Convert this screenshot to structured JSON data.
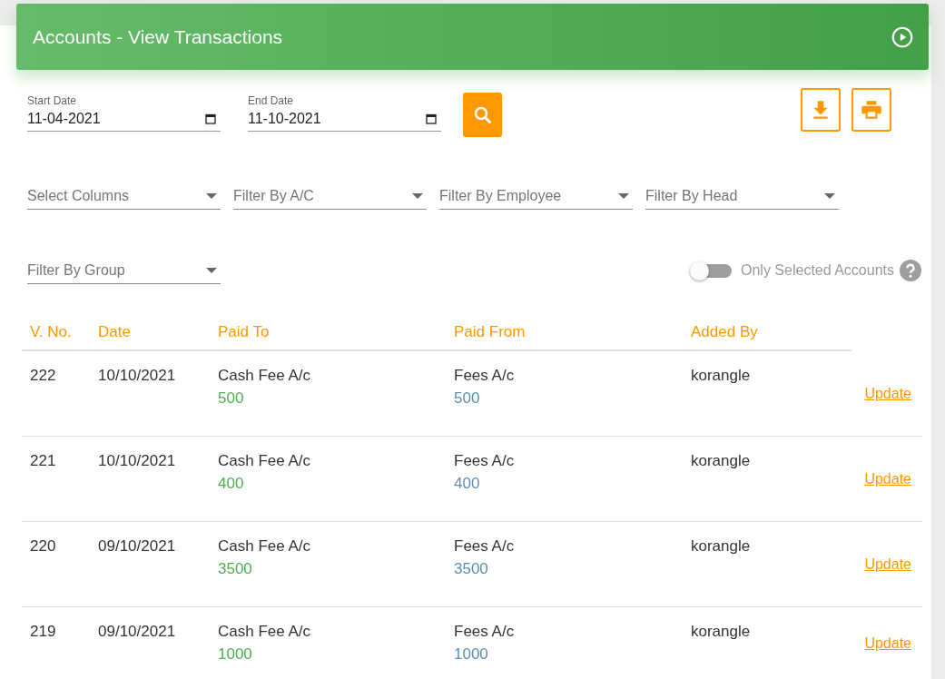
{
  "header": {
    "title": "Accounts - View Transactions"
  },
  "dates": [
    {
      "label": "Start Date",
      "value": "11-04-2021"
    },
    {
      "label": "End Date",
      "value": "11-10-2021"
    }
  ],
  "filters": [
    {
      "placeholder": "Select Columns"
    },
    {
      "placeholder": "Filter By A/C"
    },
    {
      "placeholder": "Filter By Employee"
    },
    {
      "placeholder": "Filter By Head"
    },
    {
      "placeholder": "Filter By Group"
    }
  ],
  "toggle": {
    "label": "Only Selected Accounts",
    "on": false
  },
  "table": {
    "columns": [
      "V. No.",
      "Date",
      "Paid To",
      "Paid From",
      "Added By"
    ],
    "rows": [
      {
        "vno": "222",
        "date": "10/10/2021",
        "paid_to": "Cash Fee A/c",
        "paid_to_amount": "500",
        "paid_from": "Fees A/c",
        "paid_from_amount": "500",
        "added_by": "korangle",
        "action": "Update"
      },
      {
        "vno": "221",
        "date": "10/10/2021",
        "paid_to": "Cash Fee A/c",
        "paid_to_amount": "400",
        "paid_from": "Fees A/c",
        "paid_from_amount": "400",
        "added_by": "korangle",
        "action": "Update"
      },
      {
        "vno": "220",
        "date": "09/10/2021",
        "paid_to": "Cash Fee A/c",
        "paid_to_amount": "3500",
        "paid_from": "Fees A/c",
        "paid_from_amount": "3500",
        "added_by": "korangle",
        "action": "Update"
      },
      {
        "vno": "219",
        "date": "09/10/2021",
        "paid_to": "Cash Fee A/c",
        "paid_to_amount": "1000",
        "paid_from": "Fees A/c",
        "paid_from_amount": "1000",
        "added_by": "korangle",
        "action": "Update"
      }
    ]
  }
}
